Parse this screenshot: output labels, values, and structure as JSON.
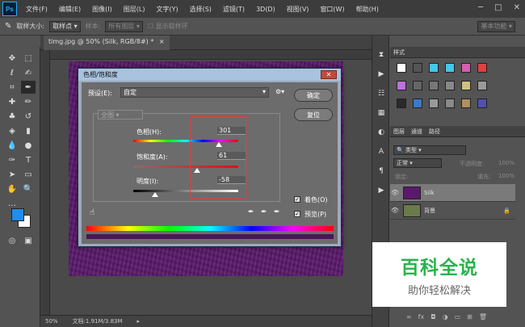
{
  "menu": {
    "logo": "Ps",
    "items": [
      "文件(F)",
      "编辑(E)",
      "图像(I)",
      "图层(L)",
      "文字(Y)",
      "选择(S)",
      "滤镜(T)",
      "3D(D)",
      "视图(V)",
      "窗口(W)",
      "帮助(H)"
    ]
  },
  "options": {
    "sample_size_label": "取样大小:",
    "sample_size_value": "取样点",
    "sample_label": "样本:",
    "sample_value": "所有图层",
    "show_ring_label": "显示取样环",
    "workspace": "基本功能"
  },
  "document": {
    "tab_title": "timg.jpg @ 50% (Silk, RGB/8#) *",
    "zoom": "50%",
    "doc_size": "文档:1.91M/3.83M"
  },
  "dialog": {
    "title": "色相/饱和度",
    "preset_label": "预设(E):",
    "preset_value": "自定",
    "channel_value": "全图",
    "hue_label": "色相(H):",
    "hue_value": "301",
    "saturation_label": "饱和度(A):",
    "saturation_value": "61",
    "lightness_label": "明度(I):",
    "lightness_value": "-58",
    "ok_label": "确定",
    "reset_label": "复位",
    "colorize_label": "着色(O)",
    "preview_label": "预览(P)",
    "colorize_checked": true,
    "preview_checked": true
  },
  "swatches_panel": {
    "title": "样式"
  },
  "layers_panel": {
    "tabs": [
      "图层",
      "通道",
      "路径"
    ],
    "filter_label": "类型",
    "blend_mode": "正常",
    "opacity_label": "不透明度:",
    "opacity_value": "100%",
    "lock_label": "锁定:",
    "fill_label": "填充:",
    "fill_value": "100%",
    "layers": [
      {
        "name": "Silk",
        "thumb_color": "#5a1a6c"
      },
      {
        "name": "背景",
        "thumb_color": "#6a7a4a"
      }
    ]
  },
  "watermark": {
    "title": "百科全说",
    "subtitle": "助你轻松解决"
  },
  "colors": {
    "foreground": "#1e8cf0",
    "background": "#ffffff",
    "highlight_box": "#e04040",
    "watermark_green": "#2ab34b"
  }
}
